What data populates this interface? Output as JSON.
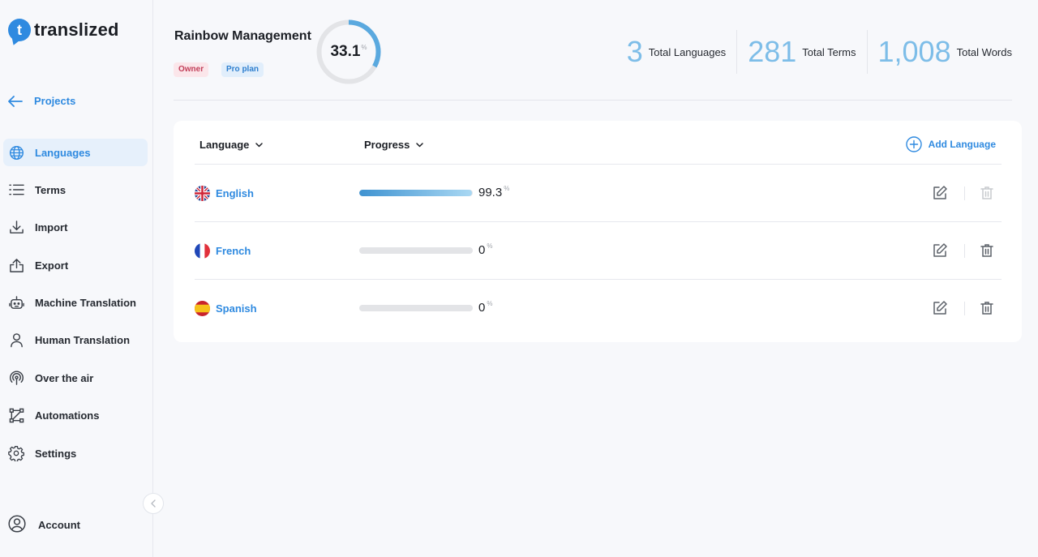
{
  "app": {
    "name": "translized"
  },
  "sidebar": {
    "back_label": "Projects",
    "items": [
      {
        "label": "Languages",
        "icon": "globe-icon",
        "active": true
      },
      {
        "label": "Terms",
        "icon": "list-icon"
      },
      {
        "label": "Import",
        "icon": "download-icon"
      },
      {
        "label": "Export",
        "icon": "upload-icon"
      },
      {
        "label": "Machine Translation",
        "icon": "robot-icon"
      },
      {
        "label": "Human Translation",
        "icon": "person-icon"
      },
      {
        "label": "Over the air",
        "icon": "broadcast-icon"
      },
      {
        "label": "Automations",
        "icon": "workflow-icon"
      },
      {
        "label": "Settings",
        "icon": "gear-icon"
      }
    ],
    "account_label": "Account"
  },
  "project": {
    "title": "Rainbow Management",
    "badges": {
      "owner": "Owner",
      "plan": "Pro plan"
    },
    "progress": {
      "value": "33.1",
      "unit": "%",
      "fraction": 0.331
    }
  },
  "stats": [
    {
      "value": "3",
      "label": "Total Languages"
    },
    {
      "value": "281",
      "label": "Total Terms"
    },
    {
      "value": "1,008",
      "label": "Total Words"
    }
  ],
  "table": {
    "col_language": "Language",
    "col_progress": "Progress",
    "add_language": "Add Language",
    "rows": [
      {
        "name": "English",
        "flag": "uk-flag-icon",
        "progress": "99.3",
        "unit": "%",
        "fraction": 0.993,
        "delete_enabled": false
      },
      {
        "name": "French",
        "flag": "france-flag-icon",
        "progress": "0",
        "unit": "%",
        "fraction": 0,
        "delete_enabled": true
      },
      {
        "name": "Spanish",
        "flag": "spain-flag-icon",
        "progress": "0",
        "unit": "%",
        "fraction": 0,
        "delete_enabled": true
      }
    ]
  },
  "colors": {
    "accent": "#2f8ae0",
    "stat": "#7dbde8",
    "ring_track": "#e3e4e7"
  }
}
